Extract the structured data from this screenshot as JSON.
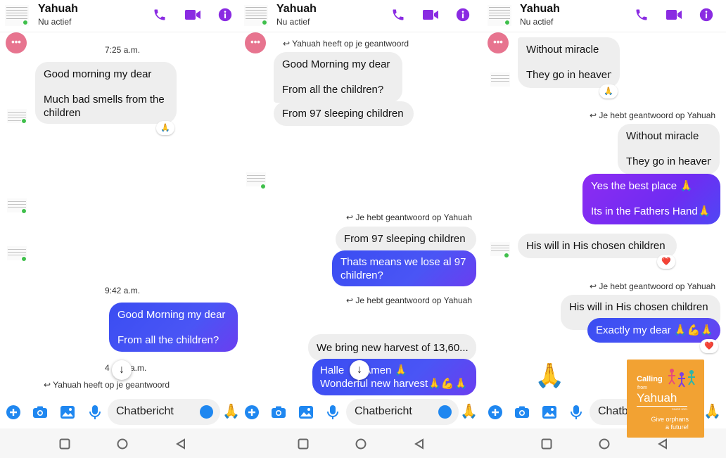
{
  "contact": {
    "name": "Yahuah",
    "status": "Nu actief"
  },
  "icons": {
    "call": "phone-icon",
    "video": "video-camera-icon",
    "info": "info-icon",
    "menu": "more-icon",
    "add": "plus-icon",
    "camera": "camera-icon",
    "gallery": "image-icon",
    "mic": "microphone-icon",
    "emoji": "emoji-icon",
    "like": "folded-hands-emoji",
    "scroll": "arrow-down-icon"
  },
  "colors": {
    "accent": "#8a2be2",
    "outgoing_blue": "#3a4df2",
    "outgoing_purple": "#8d2cf2",
    "menu_pink": "#e7748f",
    "online": "#3fbf4b"
  },
  "composer": {
    "placeholder": "Chatbericht"
  },
  "emoji": {
    "pray": "🙏",
    "heart": "❤️",
    "muscle": "💪"
  },
  "panel1": {
    "time1": "7:25 a.m.",
    "msg1": [
      "Good morning my dear",
      "Much bad smells from the",
      "children"
    ],
    "time2": "9:42 a.m.",
    "msg2": [
      "Good Morning my dear",
      "From all the children?"
    ],
    "time3_left": "4",
    "time3_right": "a.m.",
    "reply_note": "Yahuah heeft op je geantwoord"
  },
  "panel2": {
    "reply_note": "Yahuah heeft op je geantwoord",
    "msg1": [
      "Good Morning my dear",
      "From all the children?"
    ],
    "msg2": "From 97 sleeping children",
    "reply_note2": "Je hebt geantwoord op Yahuah",
    "quoted": "From 97 sleeping children",
    "msg3": [
      "Thats means we lose al 97",
      "children?"
    ],
    "reply_note3": "Je hebt geantwoord op Yahuah",
    "msg4": "We bring new harvest of 13,60...",
    "msg5_a_left": "Halle",
    "msg5_a_right": "Amen 🙏",
    "msg5_b_left": "Wonde",
    "msg5_b_right": "rful new harvest🙏💪🙏"
  },
  "panel3": {
    "msg1": [
      "Without miracle",
      "They go in heaven"
    ],
    "reply_note": "Je hebt geantwoord op Yahuah",
    "quoted": [
      "Without miracle",
      "They go in heaven"
    ],
    "msg2": [
      "Yes the best place 🙏",
      "Its in the Fathers Hand🙏"
    ],
    "msg3": "His will in His chosen children",
    "reply_note2": "Je hebt geantwoord op Yahuah",
    "quoted2": "His will in His chosen children",
    "msg4": "Exactly my dear 🙏💪🙏",
    "input_partial": "Chatb"
  },
  "logo": {
    "calling": "Calling",
    "from": "from",
    "name": "Yahuah",
    "since": "SINCE 2021",
    "tagline": [
      "Give orphans",
      "a future!"
    ]
  }
}
